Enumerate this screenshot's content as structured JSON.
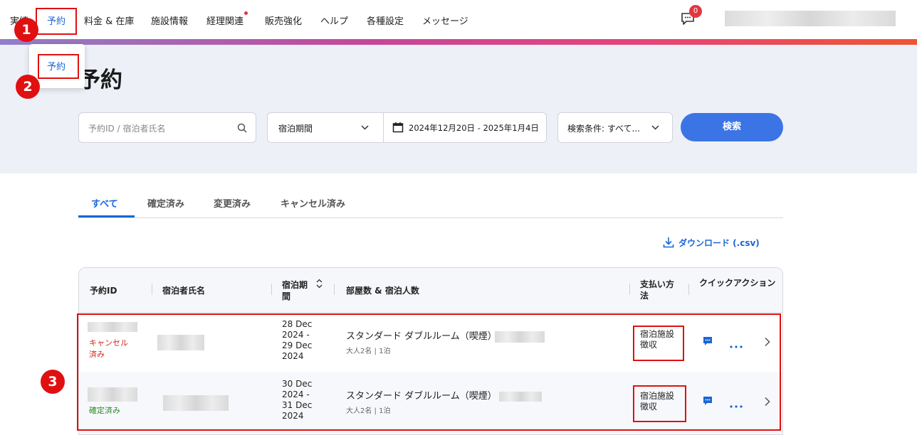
{
  "nav": {
    "items": [
      "実績",
      "予約",
      "料金 & 在庫",
      "施設情報",
      "経理関連",
      "販売強化",
      "ヘルプ",
      "各種設定",
      "メッセージ"
    ],
    "message_count": "0"
  },
  "dropdown": {
    "item": "予約"
  },
  "page": {
    "title": "予約"
  },
  "search": {
    "placeholder": "予約ID / 宿泊者氏名",
    "period_type": "宿泊期間",
    "date_range": "2024年12月20日 - 2025年1月4日",
    "conditions": "検索条件: すべて...",
    "button": "検索"
  },
  "tabs": [
    "すべて",
    "確定済み",
    "変更済み",
    "キャンセル済み"
  ],
  "download": "ダウンロード (.csv)",
  "table": {
    "headers": [
      "予約ID",
      "宿泊者氏名",
      "宿泊期間",
      "部屋数 & 宿泊人数",
      "支払い方法",
      "クイックアクション"
    ],
    "rows": [
      {
        "status": "キャンセル済み",
        "period_lines": [
          "28 Dec",
          "2024 -",
          "29 Dec",
          "2024"
        ],
        "room": "スタンダード ダブルルーム（喫煙）",
        "guests": "大人2名 | 1泊",
        "payment": "宿泊施設徴収"
      },
      {
        "status": "確定済み",
        "period_lines": [
          "30 Dec",
          "2024 -",
          "31 Dec",
          "2024"
        ],
        "room": "スタンダード ダブルルーム（喫煙）",
        "guests": "大人2名 | 1泊",
        "payment": "宿泊施設徴収"
      }
    ]
  },
  "annotations": [
    "1",
    "2",
    "3"
  ],
  "colors": {
    "accent": "#1a66d6",
    "primary_button": "#3b74e5",
    "annotation": "#e01010",
    "hero_bg": "#eef0f8"
  }
}
